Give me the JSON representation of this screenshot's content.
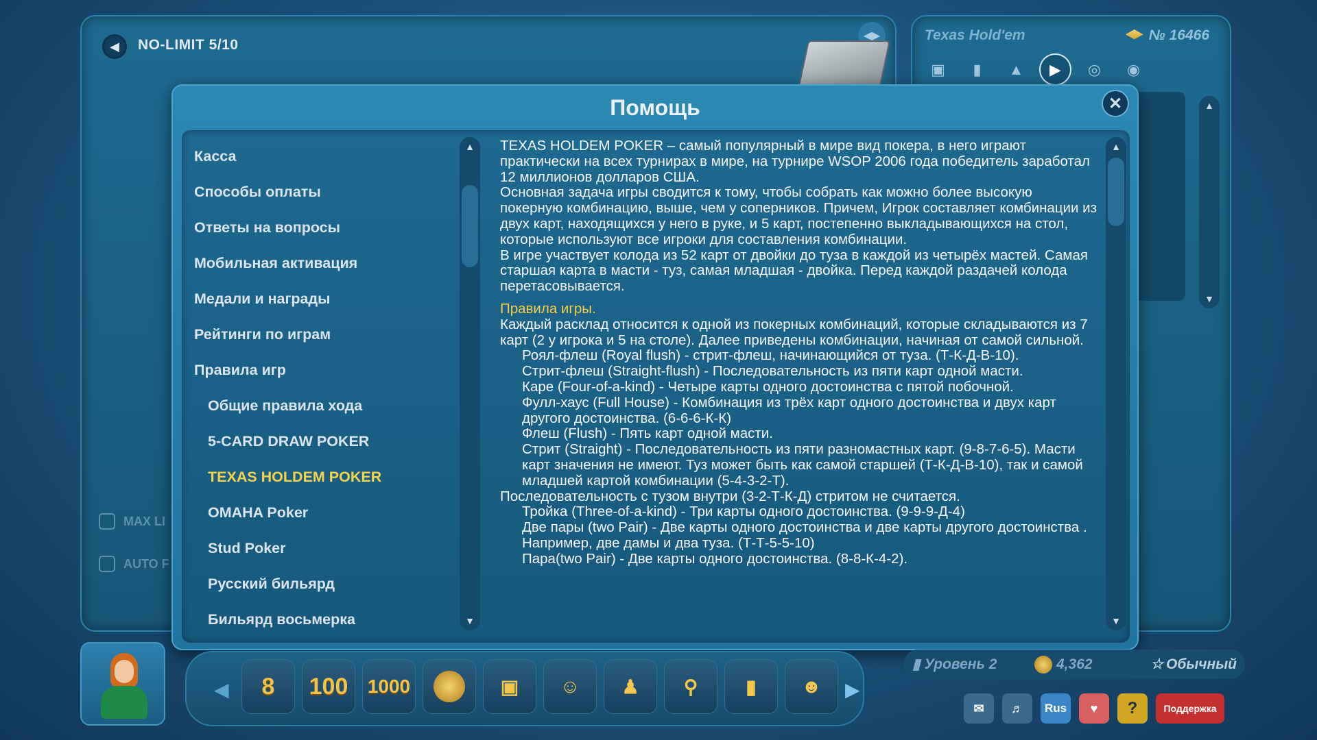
{
  "table": {
    "title": "NO-LIMIT 5/10",
    "checkbox1": "MAX LI",
    "checkbox2": "AUTO F"
  },
  "info_panel": {
    "game_name": "Texas Hold'em",
    "number": "№ 16466"
  },
  "dialog": {
    "title": "Помощь",
    "menu": [
      {
        "label": "Касса"
      },
      {
        "label": "Способы оплаты"
      },
      {
        "label": "Ответы на вопросы"
      },
      {
        "label": "Мобильная активация"
      },
      {
        "label": "Медали и награды"
      },
      {
        "label": "Рейтинги по играм"
      },
      {
        "label": "Правила игр"
      },
      {
        "label": "Общие правила хода"
      },
      {
        "label": "5-CARD DRAW POKER"
      },
      {
        "label": "TEXAS HOLDEM POKER"
      },
      {
        "label": "OMAHA Poker"
      },
      {
        "label": "Stud Poker"
      },
      {
        "label": "Русский бильярд"
      },
      {
        "label": "Бильярд восьмерка"
      }
    ],
    "content": {
      "p1": "TEXAS HOLDEM POKER – самый популярный в мире вид покера, в него играют практически на всех турнирах в мире, на турнире  WSOP 2006 года победитель заработал 12 миллионов долларов США.",
      "p2": "Основная задача игры сводится к тому, чтобы собрать как можно более высокую покерную комбинацию, выше, чем у соперников. Причем, Игрок составляет комбинации из двух карт, находящихся у него в руке, и 5 карт, постепенно выкладывающихся на стол, которые используют все игроки для составления комбинации.",
      "p3": "В игре участвует колода из 52 карт от двойки до туза в каждой из четырёх мастей. Самая старшая карта в масти - туз, самая младшая - двойка. Перед каждой раздачей колода перетасовывается.",
      "rules_heading": "Правила игры.",
      "p4": "Каждый расклад относится к одной из покерных комбинаций, которые складываются из 7 карт (2 у игрока и 5 на столе). Далее приведены комбинации, начиная от самой сильной.",
      "royal": "Роял-флеш (Royal flush) - стрит-флеш, начинающийся от туза. (Т-К-Д-В-10).",
      "straight_flush": "Стрит-флеш (Straight-flush) - Последовательность из пяти карт одной масти.",
      "four": "Каре (Four-of-a-kind) - Четыре карты одного достоинства с пятой побочной.",
      "full_house": "Фулл-хаус (Full House) - Комбинация из трёх карт одного достоинства и двух карт другого достоинства. (6-6-6-К-К)",
      "flush": "Флеш (Flush) - Пять карт одной масти.",
      "straight": "Стрит (Straight) - Последовательность из пяти разномастных карт. (9-8-7-6-5). Масти карт значения не имеют. Туз может быть как самой старшей (Т-К-Д-В-10), так и самой младшей картой комбинации (5-4-3-2-Т).",
      "ace_inside": "Последовательность с тузом внутри (3-2-Т-К-Д) стритом не считается.",
      "three": "Тройка  (Three-of-a-kind) - Три карты одного достоинства. (9-9-9-Д-4)",
      "two_pair": "Две пары (two Pair) - Две карты одного достоинства и две карты другого достоинства . Например, две дамы и два туза. (Т-Т-5-5-10)",
      "pair": "Пара(two Pair) - Две карты одного достоинства. (8-8-К-4-2)."
    }
  },
  "dock": {
    "items": [
      {
        "icon": "cards-billiard-icon",
        "text": "8"
      },
      {
        "icon": "email-100-icon",
        "text": "100"
      },
      {
        "icon": "phone-1000-icon",
        "text": "1000"
      },
      {
        "icon": "coin-icon",
        "text": ""
      },
      {
        "icon": "wallet-icon",
        "text": ""
      },
      {
        "icon": "masks-icon",
        "text": ""
      },
      {
        "icon": "players-icon",
        "text": ""
      },
      {
        "icon": "search-icon",
        "text": ""
      },
      {
        "icon": "bar-chart-icon",
        "text": ""
      },
      {
        "icon": "add-friend-icon",
        "text": ""
      }
    ]
  },
  "status": {
    "level": "Уровень 2",
    "coins": "4,362",
    "rank": "Обычный"
  },
  "bottom": {
    "lang": "Rus",
    "support": "Поддержка",
    "help": "?"
  },
  "colors": {
    "accent": "#f2d548",
    "panel": "#1f6a90",
    "support": "#c42f2f"
  }
}
